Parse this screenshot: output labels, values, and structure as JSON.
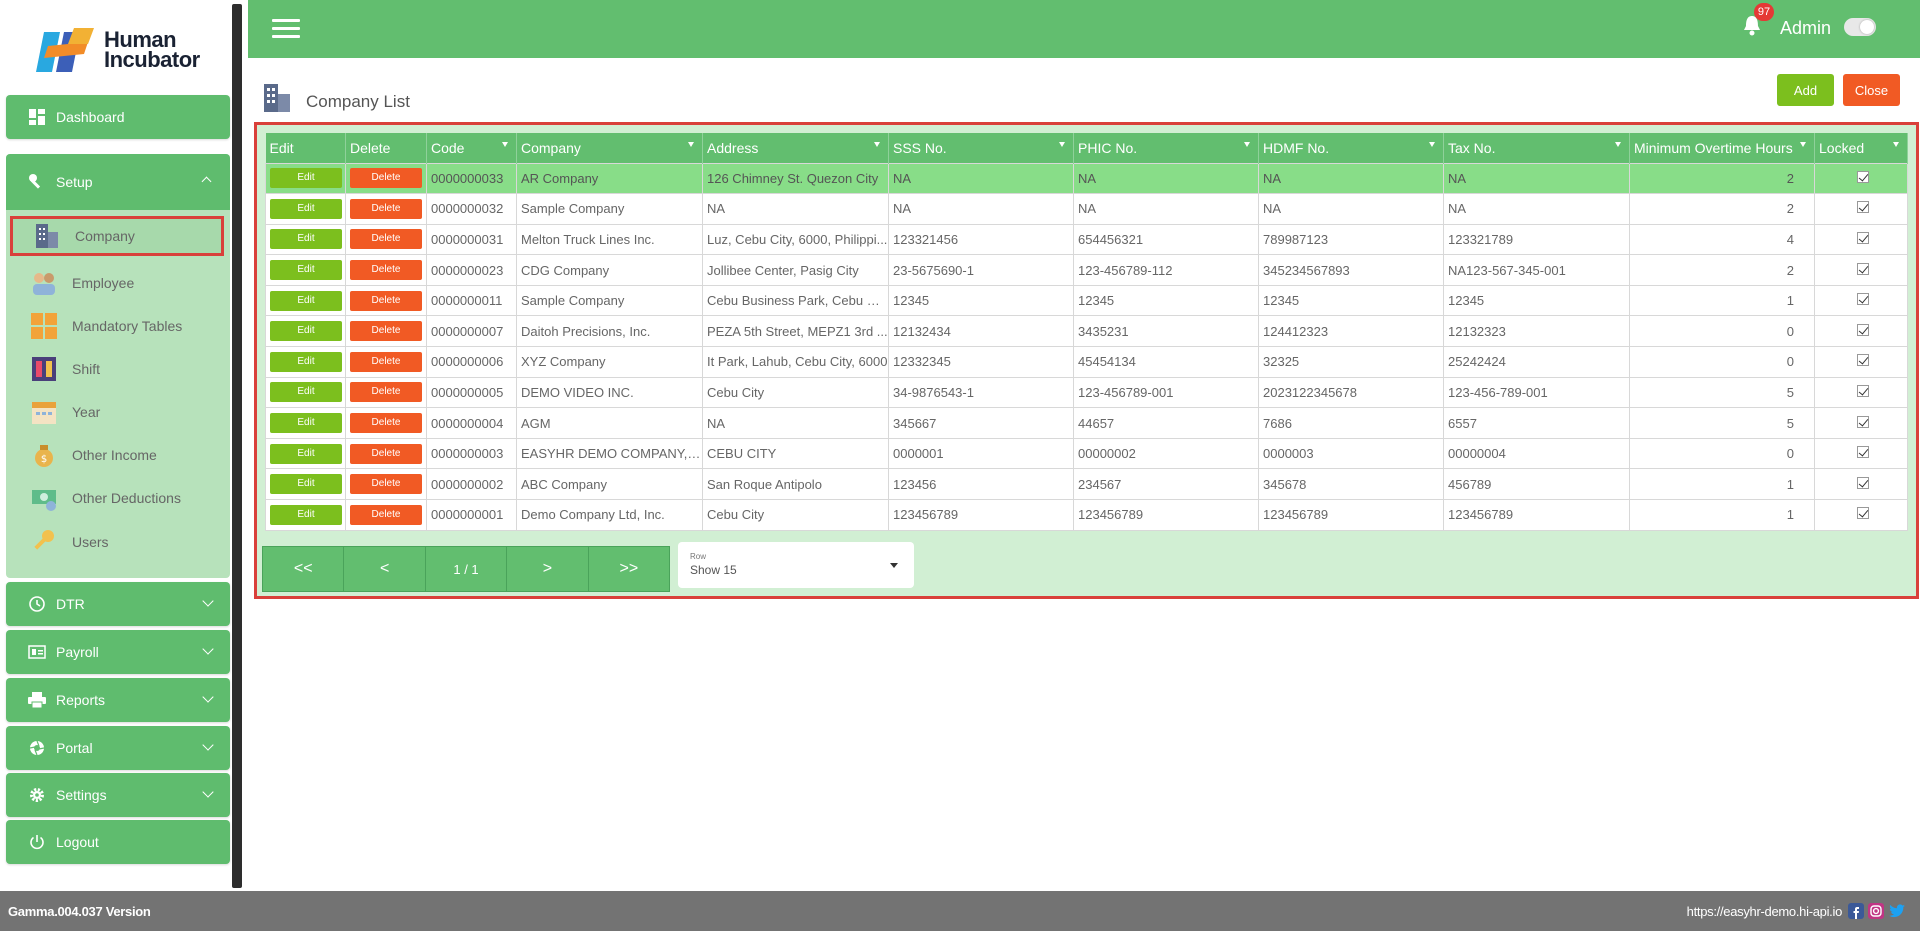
{
  "app": {
    "logo_line1": "Human",
    "logo_line2": "Incubator",
    "user": "Admin",
    "notification_count": "97"
  },
  "sidebar": {
    "dashboard": "Dashboard",
    "setup": "Setup",
    "setup_items": [
      {
        "label": "Company",
        "icon": "building-icon"
      },
      {
        "label": "Employee",
        "icon": "employee-icon"
      },
      {
        "label": "Mandatory Tables",
        "icon": "tables-icon"
      },
      {
        "label": "Shift",
        "icon": "shift-icon"
      },
      {
        "label": "Year",
        "icon": "calendar-icon"
      },
      {
        "label": "Other Income",
        "icon": "money-bag-icon"
      },
      {
        "label": "Other Deductions",
        "icon": "deductions-icon"
      },
      {
        "label": "Users",
        "icon": "key-icon"
      }
    ],
    "dtr": "DTR",
    "payroll": "Payroll",
    "reports": "Reports",
    "portal": "Portal",
    "settings": "Settings",
    "logout": "Logout"
  },
  "page": {
    "title": "Company List",
    "add_label": "Add",
    "close_label": "Close"
  },
  "grid": {
    "columns": [
      "Edit",
      "Delete",
      "Code",
      "Company",
      "Address",
      "SSS No.",
      "PHIC No.",
      "HDMF No.",
      "Tax No.",
      "Minimum Overtime Hours",
      "Locked"
    ],
    "edit_label": "Edit",
    "delete_label": "Delete",
    "rows": [
      {
        "code": "0000000033",
        "company": "AR Company",
        "address": "126 Chimney St. Quezon City",
        "sss": "NA",
        "phic": "NA",
        "hdmf": "NA",
        "tax": "NA",
        "ot": "2",
        "locked": true
      },
      {
        "code": "0000000032",
        "company": "Sample Company",
        "address": "NA",
        "sss": "NA",
        "phic": "NA",
        "hdmf": "NA",
        "tax": "NA",
        "ot": "2",
        "locked": true
      },
      {
        "code": "0000000031",
        "company": "Melton Truck Lines Inc.",
        "address": "Luz, Cebu City, 6000, Philippi...",
        "sss": "123321456",
        "phic": "654456321",
        "hdmf": "789987123",
        "tax": "123321789",
        "ot": "4",
        "locked": true
      },
      {
        "code": "0000000023",
        "company": "CDG Company",
        "address": "Jollibee Center, Pasig City",
        "sss": "23-5675690-1",
        "phic": "123-456789-112",
        "hdmf": "345234567893",
        "tax": "NA123-567-345-001",
        "ot": "2",
        "locked": true
      },
      {
        "code": "0000000011",
        "company": "Sample Company",
        "address": "Cebu Business Park, Cebu City",
        "sss": "12345",
        "phic": "12345",
        "hdmf": "12345",
        "tax": "12345",
        "ot": "1",
        "locked": true
      },
      {
        "code": "0000000007",
        "company": "Daitoh Precisions, Inc.",
        "address": "PEZA 5th Street, MEPZ1 3rd ...",
        "sss": "12132434",
        "phic": "3435231",
        "hdmf": "124412323",
        "tax": "12132323",
        "ot": "0",
        "locked": true
      },
      {
        "code": "0000000006",
        "company": "XYZ Company",
        "address": "It Park, Lahub, Cebu City, 6000",
        "sss": "12332345",
        "phic": "45454134",
        "hdmf": "32325",
        "tax": "25242424",
        "ot": "0",
        "locked": true
      },
      {
        "code": "0000000005",
        "company": "DEMO VIDEO INC.",
        "address": "Cebu City",
        "sss": "34-9876543-1",
        "phic": "123-456789-001",
        "hdmf": "2023122345678",
        "tax": "123-456-789-001",
        "ot": "5",
        "locked": true
      },
      {
        "code": "0000000004",
        "company": "AGM",
        "address": "NA",
        "sss": "345667",
        "phic": "44657",
        "hdmf": "7686",
        "tax": "6557",
        "ot": "5",
        "locked": true
      },
      {
        "code": "0000000003",
        "company": "EASYHR DEMO COMPANY, I...",
        "address": "CEBU CITY",
        "sss": "0000001",
        "phic": "00000002",
        "hdmf": "0000003",
        "tax": "00000004",
        "ot": "0",
        "locked": true
      },
      {
        "code": "0000000002",
        "company": "ABC Company",
        "address": "San Roque Antipolo",
        "sss": "123456",
        "phic": "234567",
        "hdmf": "345678",
        "tax": "456789",
        "ot": "1",
        "locked": true
      },
      {
        "code": "0000000001",
        "company": "Demo Company Ltd, Inc.",
        "address": "Cebu City",
        "sss": "123456789",
        "phic": "123456789",
        "hdmf": "123456789",
        "tax": "123456789",
        "ot": "1",
        "locked": true
      }
    ],
    "selected_row": 0
  },
  "pager": {
    "first": "<<",
    "prev": "<",
    "info": "1 / 1",
    "next": ">",
    "last": ">>",
    "rows_label": "Row",
    "rows_value": "Show 15"
  },
  "footer": {
    "version": "Gamma.004.037 Version",
    "url": "https://easyhr-demo.hi-api.io"
  },
  "colors": {
    "primary_green": "#62be6f",
    "panel_green": "#b7e2bb",
    "selected_row": "#88dd88",
    "edit_button": "#7cbf1e",
    "delete_button": "#f15a24",
    "highlight_border": "#d9403a",
    "footer_bg": "#737373"
  }
}
